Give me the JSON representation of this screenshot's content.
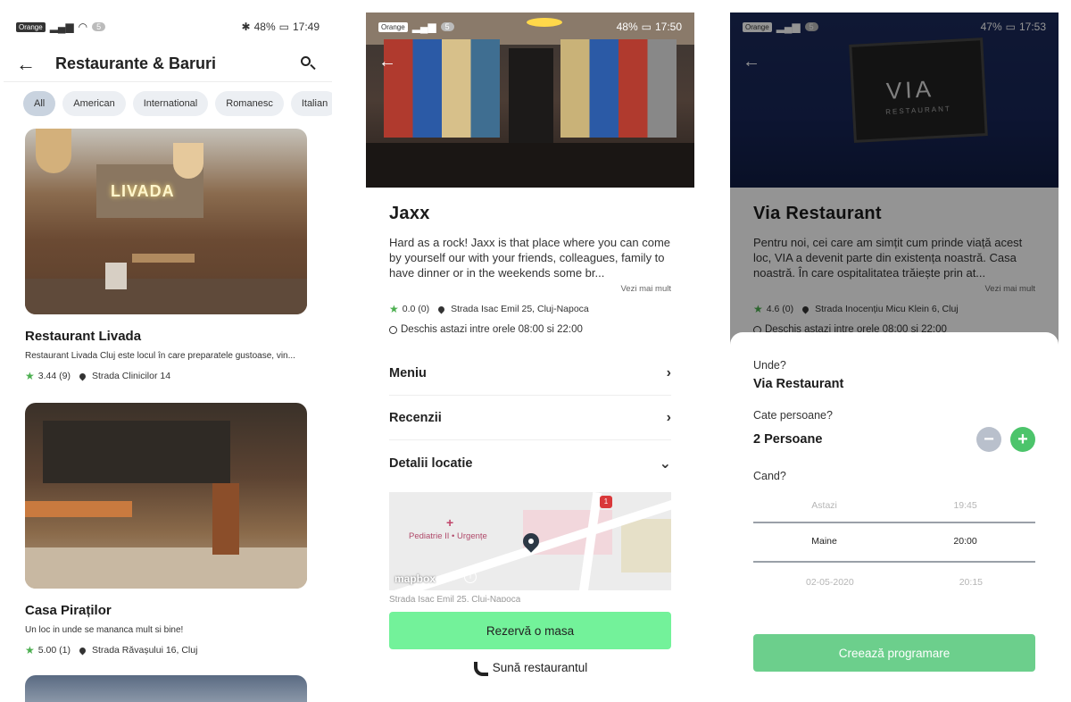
{
  "statusbar1": {
    "carrier": "Orange",
    "badge": "5",
    "battery": "48%",
    "time": "17:49"
  },
  "statusbar2": {
    "carrier": "Orange",
    "badge": "5",
    "battery": "48%",
    "time": "17:50"
  },
  "statusbar3": {
    "carrier": "Orange",
    "badge": "5",
    "battery": "47%",
    "time": "17:53"
  },
  "list_screen": {
    "title": "Restaurante & Baruri",
    "filters": [
      "All",
      "American",
      "International",
      "Romanesc",
      "Italian"
    ],
    "restaurants": [
      {
        "name": "Restaurant Livada",
        "desc": "Restaurant Livada Cluj este locul în care preparatele gustoase, vin...",
        "rating": "3.44 (9)",
        "address": "Strada Clinicilor 14",
        "photo_text": "LIVADA"
      },
      {
        "name": "Casa Piraților",
        "desc": "Un loc in unde se mananca mult si bine!",
        "rating": "5.00 (1)",
        "address": "Strada Răvașului 16, Cluj"
      }
    ]
  },
  "detail_screen": {
    "name": "Jaxx",
    "description": "Hard as a rock! Jaxx is that place where you can come by yourself our with your friends, colleagues, family to have dinner or in the weekends some br...",
    "see_more": "Vezi mai mult",
    "rating": "0.0 (0)",
    "address": "Strada Isac Emil 25, Cluj-Napoca",
    "hours": "Deschis astazi intre orele 08:00 si 22:00",
    "sections": [
      "Meniu",
      "Recenzii",
      "Detalii locatie"
    ],
    "map": {
      "poi": "Pediatrie II • Urgențe",
      "logo": "mapbox",
      "road_tag": "1"
    },
    "map_address": "Strada Isac Emil 25, Cluj-Napoca",
    "reserve_label": "Rezervă o masa",
    "call_label": "Sună restaurantul"
  },
  "booking_screen": {
    "name": "Via Restaurant",
    "sign_text": "VIA",
    "sign_subtext": "RESTAURANT",
    "description": "Pentru noi, cei care am simțit cum prinde viață acest loc, VIA a devenit parte din existența noastră. Casa noastră. În care ospitalitatea trăiește prin at...",
    "see_more": "Vezi mai mult",
    "rating": "4.6 (0)",
    "address": "Strada Inocențiu Micu Klein 6, Cluj",
    "hours": "Deschis astazi intre orele 08:00 si 22:00",
    "where_label": "Unde?",
    "where_value": "Via Restaurant",
    "persons_label": "Cate persoane?",
    "persons_value": "2 Persoane",
    "when_label": "Cand?",
    "picker": [
      {
        "day": "Astazi",
        "time": "19:45",
        "selected": false
      },
      {
        "day": "Maine",
        "time": "20:00",
        "selected": true
      },
      {
        "day": "02-05-2020",
        "time": "20:15",
        "selected": false
      }
    ],
    "create_label": "Creează programare"
  },
  "colors": {
    "accent_green": "#73f29a",
    "star_green": "#4caf50",
    "button_green": "#6ccf8c"
  }
}
